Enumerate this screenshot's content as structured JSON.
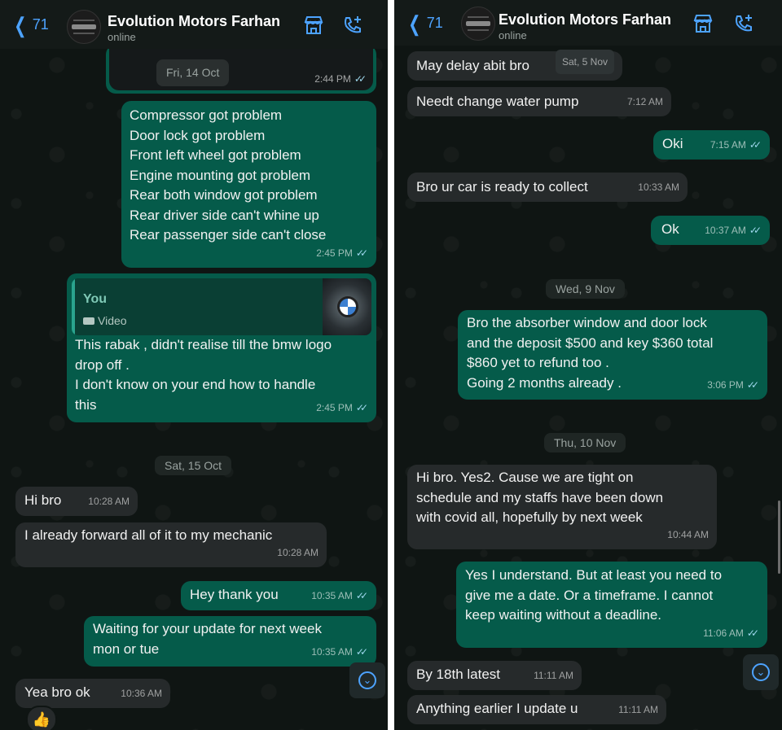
{
  "left": {
    "header": {
      "back_count": "71",
      "title": "Evolution Motors Farhan",
      "status": "online"
    },
    "photo_msg": {
      "date": "Fri, 14 Oct",
      "time": "2:44 PM"
    },
    "list_msg": {
      "text": "Compressor got problem\nDoor lock got problem\nFront left wheel got problem\nEngine mounting got problem\nRear both window got problem\nRear driver side can't whine up\nRear passenger side can't close",
      "time": "2:45 PM"
    },
    "reply_msg": {
      "quote_name": "You",
      "quote_type": "Video",
      "text": "This rabak , didn't realise till the bmw logo\ndrop off .\nI don't know on your end how to handle\nthis",
      "time": "2:45 PM"
    },
    "date_sep": "Sat, 15 Oct",
    "msgs": [
      {
        "text": "Hi bro",
        "time": "10:28 AM"
      },
      {
        "text": "I already forward all of it to my mechanic",
        "time": "10:28 AM"
      },
      {
        "text": "Hey thank you",
        "time": "10:35 AM"
      },
      {
        "text": "Waiting for your update for next week\nmon or tue",
        "time": "10:35 AM"
      },
      {
        "text": "Yea bro ok",
        "time": "10:36 AM"
      }
    ],
    "reaction": "👍"
  },
  "right": {
    "header": {
      "back_count": "71",
      "title": "Evolution Motors Farhan",
      "status": "online"
    },
    "msgs": [
      {
        "text": "May delay abit bro",
        "time": "Sat, 5 Nov"
      },
      {
        "text": "Needt change water pump",
        "time": "7:12 AM"
      },
      {
        "text": "Oki",
        "time": "7:15 AM"
      },
      {
        "text": "Bro ur car is ready to collect",
        "time": "10:33 AM"
      },
      {
        "text": "Ok",
        "time": "10:37 AM"
      },
      {
        "text": "Bro the absorber window and door lock\nand the deposit $500 and key $360 total\n$860 yet to refund too .\nGoing 2 months already .",
        "time": "3:06 PM"
      },
      {
        "text": "Hi bro. Yes2. Cause we are tight on\nschedule and my staffs have been down\nwith covid all, hopefully by next week",
        "time": "10:44 AM"
      },
      {
        "text": "Yes I understand. But at least you need to\ngive me a date. Or a timeframe. I cannot\nkeep waiting without a deadline.",
        "time": "11:06 AM"
      },
      {
        "text": "By 18th latest",
        "time": "11:11 AM"
      },
      {
        "text": "Anything earlier I update u",
        "time": "11:11 AM"
      }
    ],
    "date_sep_1": "Wed, 9 Nov",
    "date_sep_2": "Thu, 10 Nov"
  },
  "colors": {
    "incoming": "#262a2b",
    "outgoing": "#055b4a",
    "accent": "#4da3ff",
    "background": "#0f1513"
  },
  "icons": [
    "chevron-left-icon",
    "storefront-icon",
    "phone-add-icon",
    "double-check-icon",
    "video-icon",
    "chevron-down-icon"
  ]
}
